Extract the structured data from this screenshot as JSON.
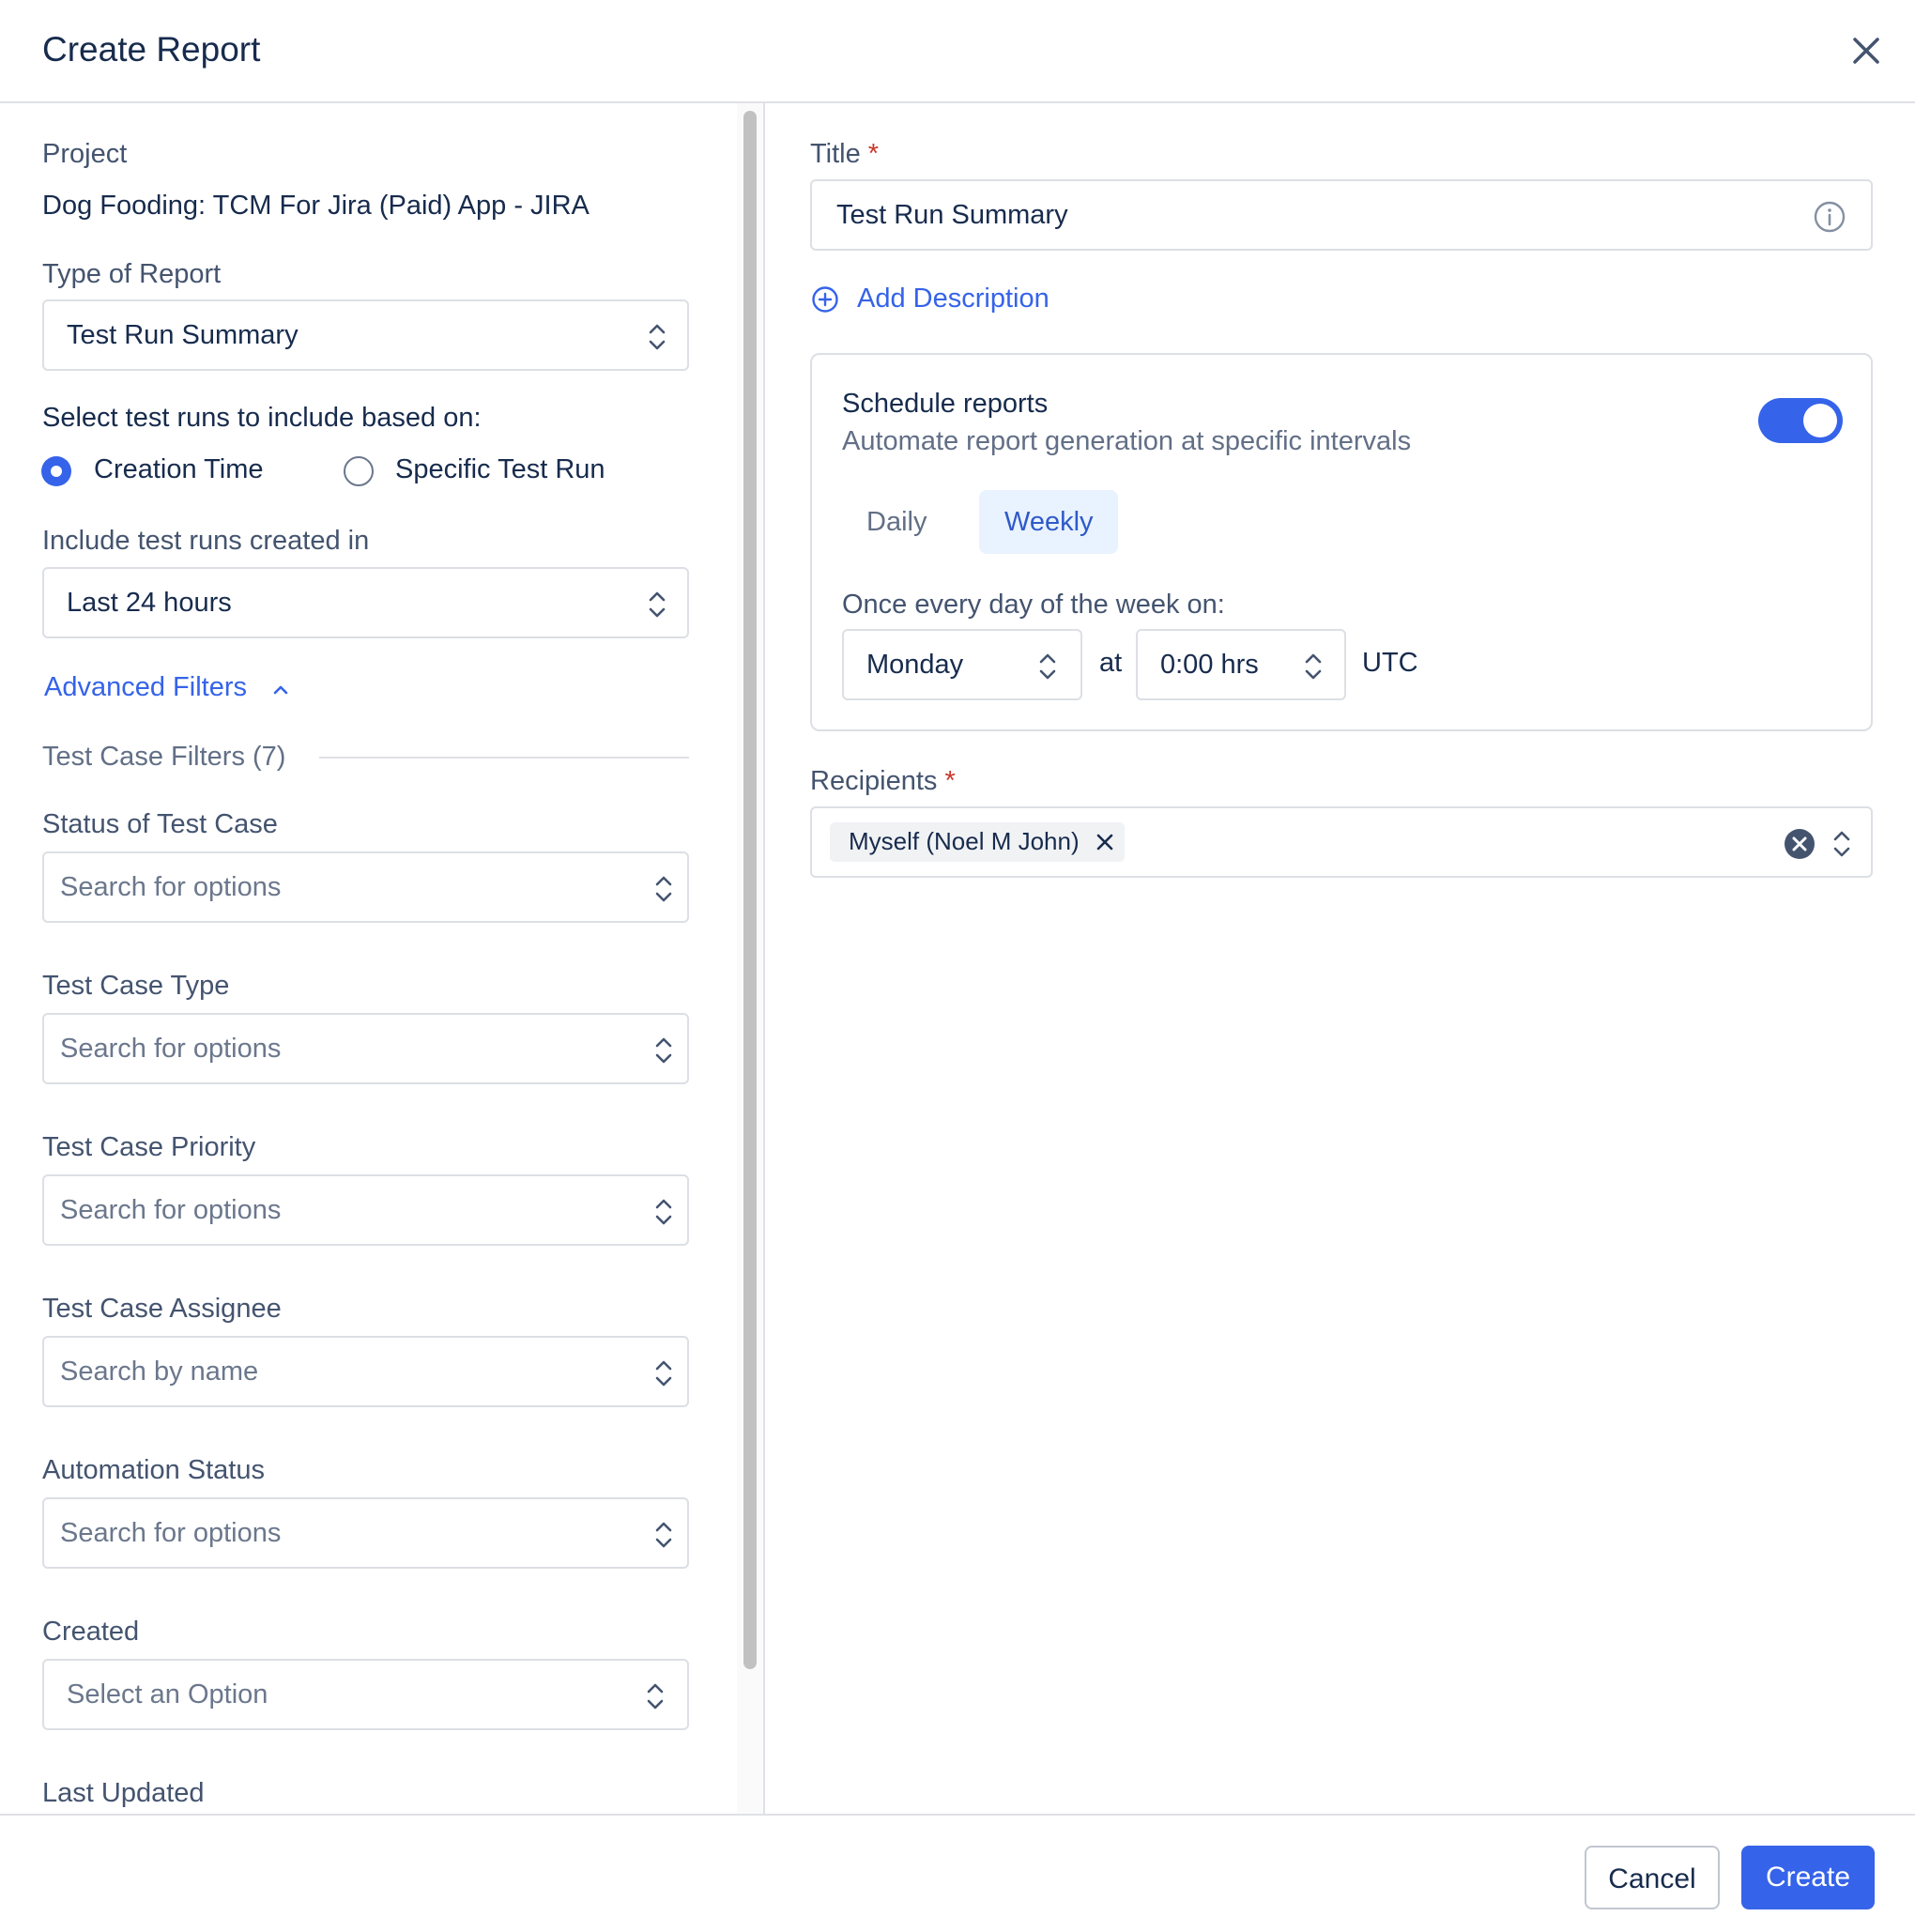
{
  "dialog": {
    "title": "Create Report"
  },
  "left": {
    "project_label": "Project",
    "project_value": "Dog Fooding: TCM For Jira (Paid) App - JIRA",
    "type_label": "Type of Report",
    "type_value": "Test Run Summary",
    "select_runs_label": "Select test runs to include based on:",
    "radio_options": [
      {
        "label": "Creation Time",
        "selected": true
      },
      {
        "label": "Specific Test Run",
        "selected": false
      }
    ],
    "include_label": "Include test runs created in",
    "include_value": "Last 24 hours",
    "advanced_filters": "Advanced Filters",
    "test_case_filters": "Test Case Filters (7)",
    "filters": [
      {
        "label": "Status of Test Case",
        "placeholder": "Search for options"
      },
      {
        "label": "Test Case Type",
        "placeholder": "Search for options"
      },
      {
        "label": "Test Case Priority",
        "placeholder": "Search for options"
      },
      {
        "label": "Test Case Assignee",
        "placeholder": "Search by name"
      },
      {
        "label": "Automation Status",
        "placeholder": "Search for options"
      },
      {
        "label": "Created",
        "placeholder": "Select an Option"
      },
      {
        "label": "Last Updated"
      }
    ]
  },
  "right": {
    "title_label": "Title",
    "required_mark": "*",
    "title_value": "Test Run Summary",
    "add_description": "Add Description",
    "schedule": {
      "heading": "Schedule reports",
      "subtext": "Automate report generation at specific intervals",
      "enabled": true,
      "tabs": [
        {
          "label": "Daily",
          "active": false
        },
        {
          "label": "Weekly",
          "active": true
        }
      ],
      "frequency_label": "Once every day of the week on:",
      "day": "Monday",
      "at": "at",
      "time": "0:00 hrs",
      "timezone": "UTC"
    },
    "recipients_label": "Recipients",
    "recipients": [
      "Myself (Noel M John)"
    ]
  },
  "footer": {
    "cancel": "Cancel",
    "create": "Create"
  },
  "colors": {
    "accent": "#3563e9",
    "required": "#c9372c",
    "border": "#dcdfe4"
  },
  "icons": [
    "close-icon",
    "chevron-updown-icon",
    "info-icon",
    "plus-circle-icon",
    "chevron-up-icon",
    "clear-icon",
    "remove-icon"
  ]
}
